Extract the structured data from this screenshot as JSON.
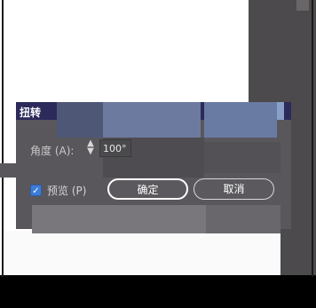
{
  "dialog": {
    "title": "扭转",
    "angle_label": "角度 (A):",
    "angle_value": "100°",
    "preview_label": "预览 (P)",
    "preview_checked": true,
    "ok_label": "确定",
    "cancel_label": "取消",
    "spinner_up": "▲",
    "spinner_down": "▼",
    "checkmark": "✓"
  },
  "colors": {
    "dialog_bg": "#59575b",
    "titlebar_bg": "#2c2a5a",
    "checkbox_accent": "#3d7dd8"
  }
}
